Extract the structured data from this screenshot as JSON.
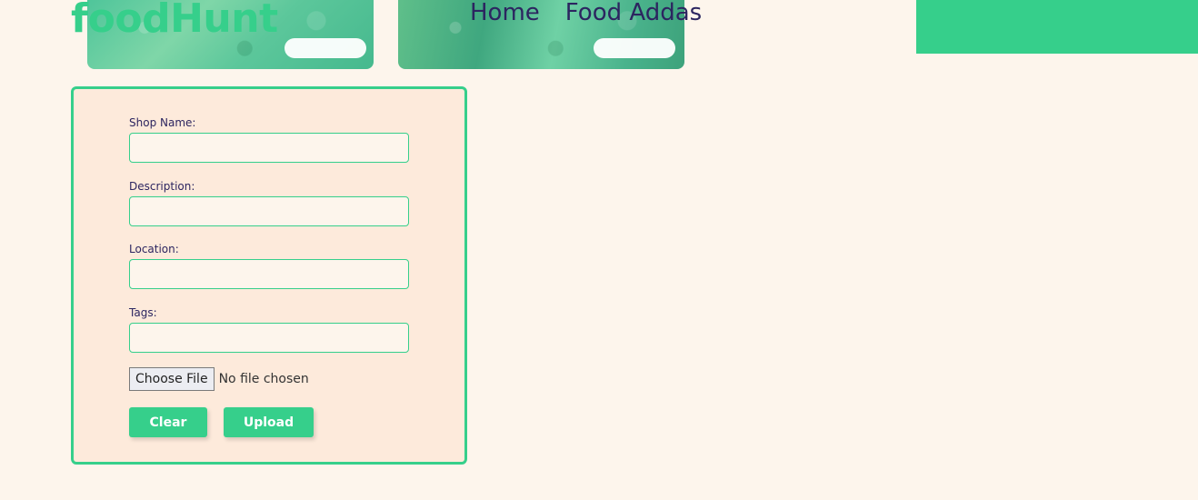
{
  "brand": {
    "name": "foodHunt",
    "color": "#36cf8b"
  },
  "nav": {
    "items": [
      {
        "label": "Home"
      },
      {
        "label": "Food Addas"
      }
    ]
  },
  "form": {
    "shop_name": {
      "label": "Shop Name:",
      "value": ""
    },
    "description": {
      "label": "Description:",
      "value": ""
    },
    "location": {
      "label": "Location:",
      "value": ""
    },
    "tags": {
      "label": "Tags:",
      "value": ""
    },
    "file": {
      "button_label": "Choose File",
      "status": "No file chosen"
    },
    "clear_label": "Clear",
    "upload_label": "Upload"
  },
  "colors": {
    "accent": "#36cf8b",
    "text": "#2c2560",
    "background": "#fdf5ec",
    "card": "#fdeadb"
  }
}
